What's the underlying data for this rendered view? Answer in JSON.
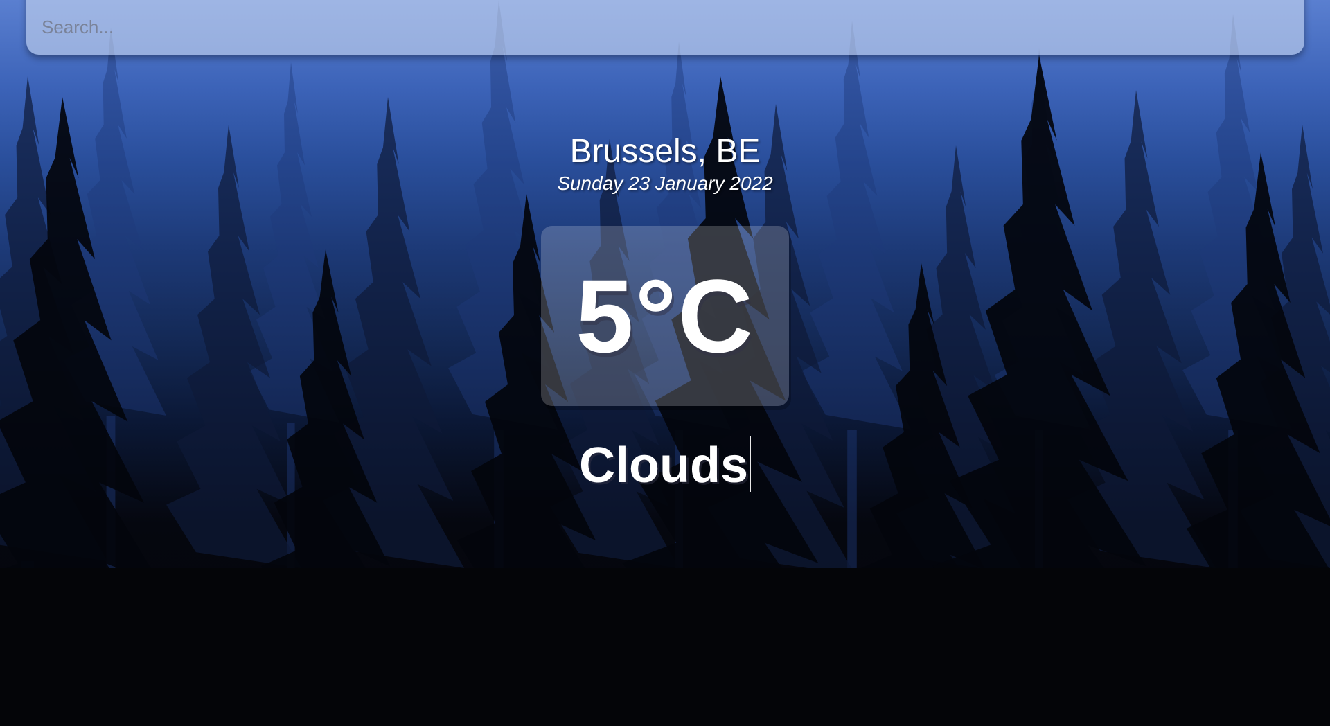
{
  "search": {
    "placeholder": "Search...",
    "value": ""
  },
  "location": {
    "city": "Brussels, BE",
    "date": "Sunday 23 January 2022"
  },
  "weather": {
    "temperature": "5°C",
    "condition": "Clouds"
  },
  "background": {
    "icon": "pine-forest-icon",
    "sky_top": "#5a7fd0",
    "ground": "#040508"
  }
}
